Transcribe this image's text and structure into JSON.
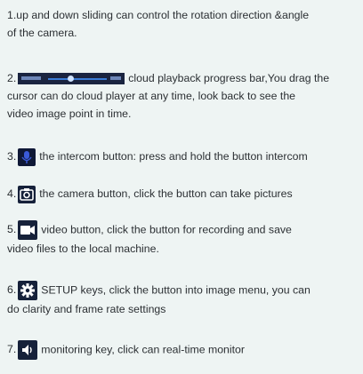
{
  "items": [
    {
      "lines": [
        "1.up and down sliding can control the rotation direction &angle",
        "of the camera."
      ]
    },
    {
      "num": "2.",
      "lines": [
        "cloud playback progress bar,You drag the",
        "cursor can do cloud player at any time, look back to see the",
        "video image point in time."
      ],
      "icon": "progress-bar-icon"
    },
    {
      "num": "3.",
      "lines": [
        "the intercom button: press and hold the button intercom"
      ],
      "icon": "microphone-icon"
    },
    {
      "num": "4.",
      "lines": [
        "the camera button, click the button can take pictures"
      ],
      "icon": "camera-icon"
    },
    {
      "num": "5.",
      "lines": [
        "video button, click the button for recording and save",
        "video files to the local machine."
      ],
      "icon": "video-camera-icon"
    },
    {
      "num": "6.",
      "lines": [
        "SETUP keys, click the button into image menu, you can",
        "do clarity and frame rate settings"
      ],
      "icon": "gear-icon"
    },
    {
      "num": "7.",
      "lines": [
        "monitoring key, click can real-time monitor"
      ],
      "icon": "speaker-icon"
    }
  ],
  "colors": {
    "background": "#eef4f3",
    "text": "#2b2f33",
    "icon_bg": "#16213a"
  }
}
